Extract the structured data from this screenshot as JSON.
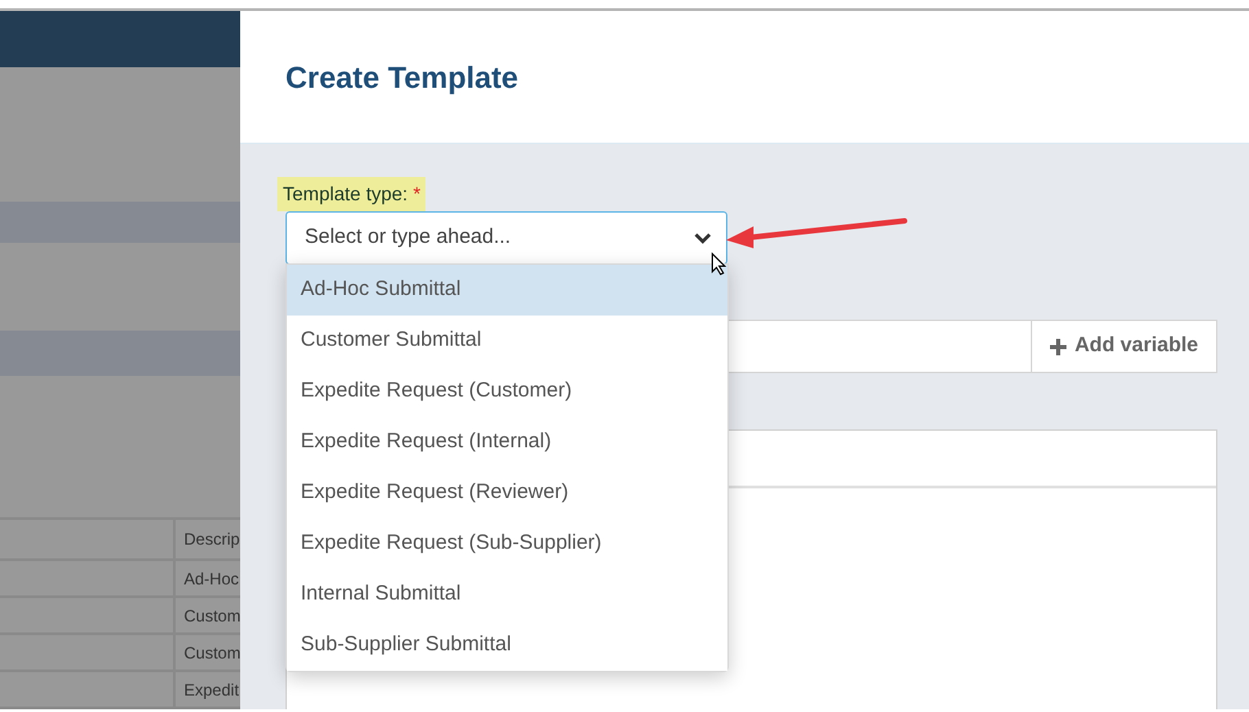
{
  "background_table": {
    "header": "Descrip",
    "rows": [
      "Ad-Hoc",
      "Custom",
      "Custom",
      "Expedit"
    ]
  },
  "modal": {
    "title": "Create Template",
    "template_type": {
      "label": "Template type:",
      "required_mark": "*",
      "placeholder": "Select or type ahead...",
      "expanded": true,
      "options": [
        {
          "label": "Ad-Hoc Submittal",
          "selected": true
        },
        {
          "label": "Customer Submittal",
          "selected": false
        },
        {
          "label": "Expedite Request (Customer)",
          "selected": false
        },
        {
          "label": "Expedite Request (Internal)",
          "selected": false
        },
        {
          "label": "Expedite Request (Reviewer)",
          "selected": false
        },
        {
          "label": "Expedite Request (Sub-Supplier)",
          "selected": false
        },
        {
          "label": "Internal Submittal",
          "selected": false
        },
        {
          "label": "Sub-Supplier Submittal",
          "selected": false
        }
      ]
    },
    "add_variable_button": "Add variable"
  }
}
